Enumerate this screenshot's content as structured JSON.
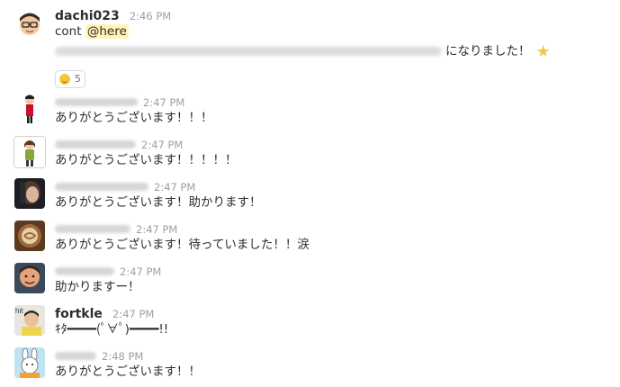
{
  "messages": [
    {
      "user": "dachi023",
      "time": "2:46 PM",
      "line1_prefix": "cont ",
      "mention": "@here",
      "line2_suffix": "になりました！",
      "star_icon": "star-icon",
      "reaction": {
        "emoji": "smile-emoji-icon",
        "count": "5"
      }
    },
    {
      "user": "",
      "time": "2:47 PM",
      "text": "ありがとうございます！！！"
    },
    {
      "user": "",
      "time": "2:47 PM",
      "text": "ありがとうございます！！！！！"
    },
    {
      "user": "",
      "time": "2:47 PM",
      "text": "ありがとうございます！助かります！"
    },
    {
      "user": "",
      "time": "2:47 PM",
      "text": "ありがとうございます！待っていました！！涙"
    },
    {
      "user": "",
      "time": "2:47 PM",
      "text": "助かりますー！"
    },
    {
      "user": "fortkle",
      "time": "2:47 PM",
      "text": "ｷﾀ━━━━(ﾟ∀ﾟ)━━━━!!"
    },
    {
      "user": "",
      "time": "2:48 PM",
      "text": "ありがとうございます！！"
    }
  ]
}
